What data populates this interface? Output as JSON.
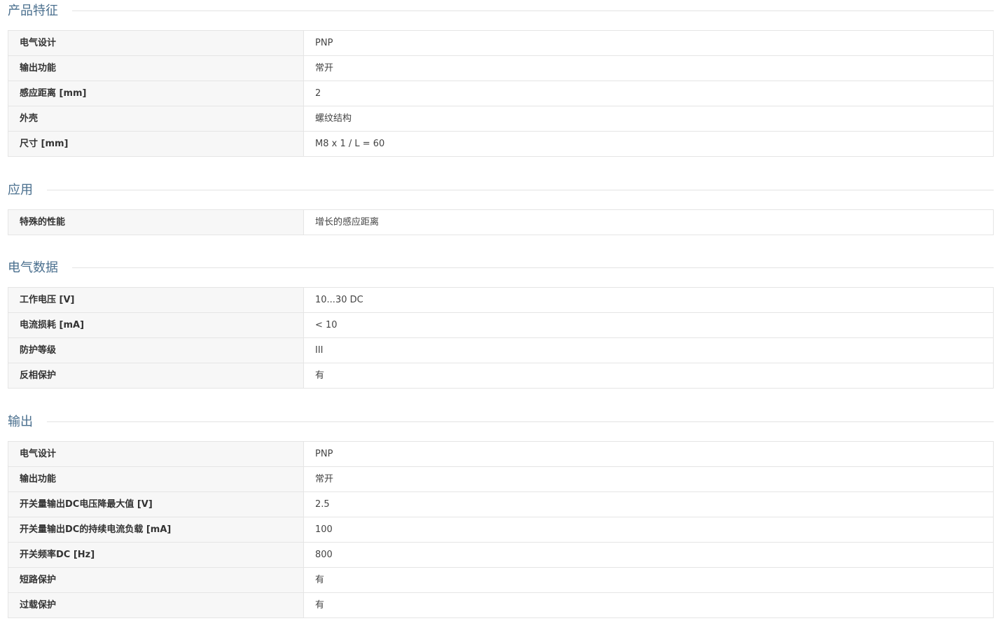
{
  "sections": [
    {
      "title": "产品特征",
      "rows": [
        {
          "label": "电气设计",
          "value": "PNP"
        },
        {
          "label": "输出功能",
          "value": "常开"
        },
        {
          "label": "感应距离 [mm]",
          "value": "2"
        },
        {
          "label": "外壳",
          "value": "螺纹结构"
        },
        {
          "label": "尺寸 [mm]",
          "value": "M8 x 1 / L = 60"
        }
      ]
    },
    {
      "title": "应用",
      "rows": [
        {
          "label": "特殊的性能",
          "value": "增长的感应距离"
        }
      ]
    },
    {
      "title": "电气数据",
      "rows": [
        {
          "label": "工作电压 [V]",
          "value": "10...30 DC"
        },
        {
          "label": "电流损耗 [mA]",
          "value": "< 10"
        },
        {
          "label": "防护等级",
          "value": "III"
        },
        {
          "label": "反相保护",
          "value": "有"
        }
      ]
    },
    {
      "title": "输出",
      "rows": [
        {
          "label": "电气设计",
          "value": "PNP"
        },
        {
          "label": "输出功能",
          "value": "常开"
        },
        {
          "label": "开关量输出DC电压降最大值 [V]",
          "value": "2.5"
        },
        {
          "label": "开关量输出DC的持续电流负载 [mA]",
          "value": "100"
        },
        {
          "label": "开关频率DC [Hz]",
          "value": "800"
        },
        {
          "label": "短路保护",
          "value": "有"
        },
        {
          "label": "过载保护",
          "value": "有"
        }
      ]
    }
  ]
}
